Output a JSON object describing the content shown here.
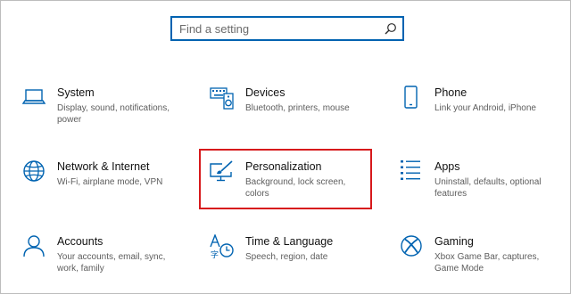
{
  "search": {
    "placeholder": "Find a setting",
    "icon": "search-icon"
  },
  "colors": {
    "accent": "#0063b1",
    "highlight": "#d7191c"
  },
  "tiles": [
    {
      "title": "System",
      "desc": "Display, sound, notifications, power",
      "icon": "laptop-icon"
    },
    {
      "title": "Devices",
      "desc": "Bluetooth, printers, mouse",
      "icon": "keyboard-speaker-icon"
    },
    {
      "title": "Phone",
      "desc": "Link your Android, iPhone",
      "icon": "phone-icon"
    },
    {
      "title": "Network & Internet",
      "desc": "Wi-Fi, airplane mode, VPN",
      "icon": "globe-icon"
    },
    {
      "title": "Personalization",
      "desc": "Background, lock screen, colors",
      "icon": "paintbrush-monitor-icon"
    },
    {
      "title": "Apps",
      "desc": "Uninstall, defaults, optional features",
      "icon": "apps-list-icon"
    },
    {
      "title": "Accounts",
      "desc": "Your accounts, email, sync, work, family",
      "icon": "person-icon"
    },
    {
      "title": "Time & Language",
      "desc": "Speech, region, date",
      "icon": "time-language-icon"
    },
    {
      "title": "Gaming",
      "desc": "Xbox Game Bar, captures, Game Mode",
      "icon": "xbox-icon"
    }
  ]
}
